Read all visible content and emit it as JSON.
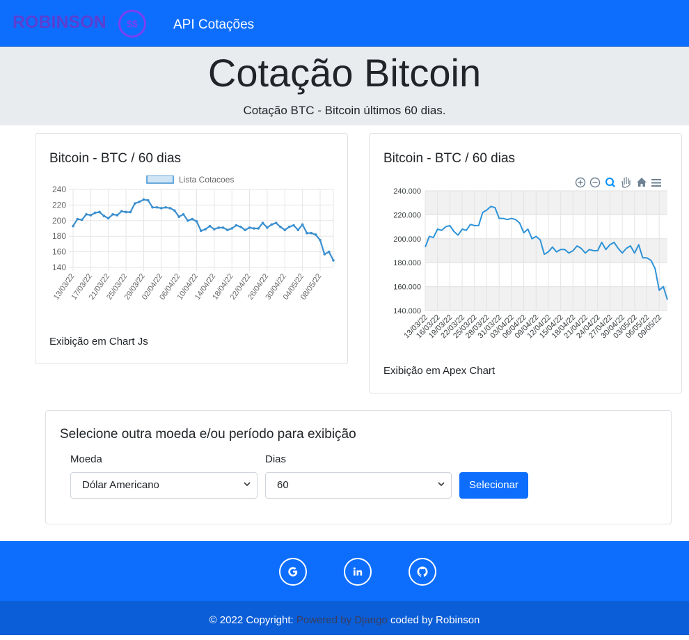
{
  "navbar": {
    "brand": "ROBINSON",
    "brand_icon": "$$",
    "link": "API Cotações"
  },
  "hero": {
    "title": "Cotação Bitcoin",
    "subtitle": "Cotação BTC - Bitcoin últimos 60 dias."
  },
  "chartjs_card": {
    "title": "Bitcoin - BTC / 60 dias",
    "caption": "Exibição em Chart Js"
  },
  "apex_card": {
    "title": "Bitcoin - BTC / 60 dias",
    "caption": "Exibição em Apex Chart"
  },
  "form": {
    "heading": "Selecione outra moeda e/ou período para exibição",
    "moeda_label": "Moeda",
    "moeda_value": "Dólar Americano",
    "dias_label": "Dias",
    "dias_value": "60",
    "button": "Selecionar"
  },
  "footer": {
    "social": [
      "google-icon",
      "linkedin-icon",
      "github-icon"
    ],
    "copyright_prefix": "© 2022 Copyright:",
    "copyright_muted": "Powered by Django",
    "copyright_suffix": "coded by Robinson"
  },
  "chart_data": [
    {
      "type": "line",
      "title": "",
      "legend": [
        "Lista Cotacoes"
      ],
      "legend_position": "top",
      "ylim": [
        140,
        240
      ],
      "y_ticks": [
        "240",
        "220",
        "200",
        "180",
        "160",
        "140"
      ],
      "x_tick_labels": [
        "13/03/22",
        "17/03/22",
        "21/03/22",
        "25/03/22",
        "29/03/22",
        "02/04/22",
        "06/04/22",
        "10/04/22",
        "14/04/22",
        "18/04/22",
        "22/04/22",
        "26/04/22",
        "30/04/22",
        "04/05/22",
        "08/05/22"
      ],
      "series": [
        {
          "name": "Lista Cotacoes",
          "values": [
            193,
            202,
            201,
            208,
            207,
            210,
            211,
            206,
            203,
            208,
            207,
            212,
            211,
            211,
            222,
            224,
            227,
            226,
            217,
            217,
            216,
            217,
            216,
            213,
            205,
            208,
            200,
            202,
            199,
            187,
            189,
            193,
            189,
            191,
            191,
            188,
            190,
            194,
            192,
            188,
            191,
            190,
            190,
            197,
            191,
            195,
            197,
            192,
            188,
            192,
            194,
            188,
            195,
            184,
            184,
            182,
            175,
            157,
            160,
            149
          ]
        }
      ]
    },
    {
      "type": "line",
      "title": "",
      "ylim": [
        140000,
        240000
      ],
      "y_ticks": [
        "240.000",
        "220.000",
        "200.000",
        "180.000",
        "160.000",
        "140.000"
      ],
      "x_tick_labels": [
        "13/03/22",
        "16/03/22",
        "19/03/22",
        "22/03/22",
        "25/03/22",
        "28/03/22",
        "31/03/22",
        "03/04/22",
        "06/04/22",
        "09/04/22",
        "12/04/22",
        "15/04/22",
        "18/04/22",
        "21/04/22",
        "24/04/22",
        "27/04/22",
        "30/04/22",
        "03/05/22",
        "06/05/22",
        "09/05/22"
      ],
      "toolbar": [
        "zoom-in-icon",
        "zoom-out-icon",
        "selection-zoom-icon",
        "pan-hand-icon",
        "home-reset-icon",
        "menu-icon"
      ],
      "grid": true,
      "series": [
        {
          "values": [
            193000,
            202000,
            201000,
            208000,
            207000,
            210000,
            211000,
            206000,
            203000,
            208000,
            207000,
            212000,
            211000,
            211000,
            222000,
            224000,
            227000,
            226000,
            217000,
            217000,
            216000,
            217000,
            216000,
            213000,
            205000,
            208000,
            200000,
            202000,
            199000,
            187000,
            189000,
            193000,
            189000,
            191000,
            191000,
            188000,
            190000,
            194000,
            192000,
            188000,
            191000,
            190000,
            190000,
            197000,
            191000,
            195000,
            197000,
            192000,
            188000,
            192000,
            194000,
            188000,
            195000,
            184000,
            184000,
            182000,
            175000,
            157000,
            160000,
            149000
          ]
        }
      ]
    }
  ]
}
